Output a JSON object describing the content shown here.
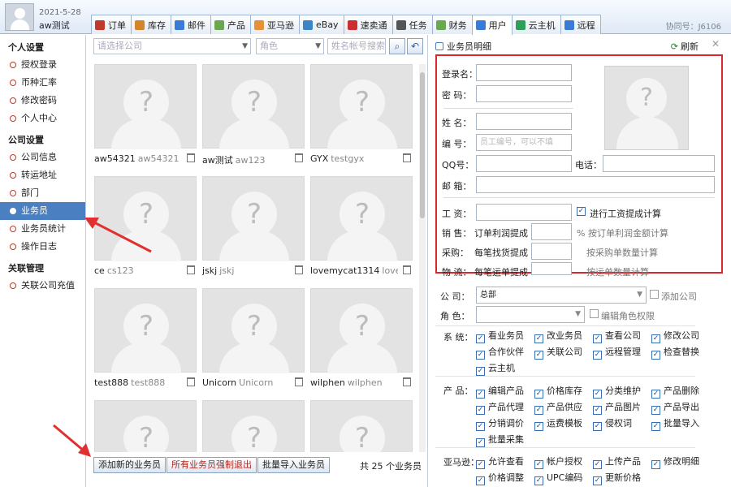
{
  "top": {
    "date": "2021-5-28",
    "user": "aw测试",
    "assistant_no": "协同号：J6106",
    "tabs": [
      {
        "label": "订单",
        "icon": "order-icon",
        "color": "#c0392b"
      },
      {
        "label": "库存",
        "icon": "stock-icon",
        "color": "#d4842a"
      },
      {
        "label": "邮件",
        "icon": "mail-icon",
        "color": "#3a7bd5"
      },
      {
        "label": "产品",
        "icon": "product-icon",
        "color": "#6aa84f"
      },
      {
        "label": "亚马逊",
        "icon": "amazon-icon",
        "color": "#e69138"
      },
      {
        "label": "eBay",
        "icon": "ebay-icon",
        "color": "#3d85c6"
      },
      {
        "label": "速卖通",
        "icon": "aliexpress-icon",
        "color": "#cc2f2f"
      },
      {
        "label": "任务",
        "icon": "task-icon",
        "color": "#555555"
      },
      {
        "label": "财务",
        "icon": "finance-icon",
        "color": "#6aa84f"
      },
      {
        "label": "用户",
        "icon": "user-icon",
        "color": "#3a7bd5"
      },
      {
        "label": "云主机",
        "icon": "cloud-host-icon",
        "color": "#2e9e5b"
      },
      {
        "label": "远程",
        "icon": "remote-icon",
        "color": "#3a7bd5"
      }
    ],
    "active_tab": "用户"
  },
  "nav": {
    "personal_title": "个人设置",
    "personal": [
      "授权登录",
      "币种汇率",
      "修改密码",
      "个人中心"
    ],
    "company_title": "公司设置",
    "company": [
      "公司信息",
      "转运地址",
      "部门",
      "业务员",
      "业务员统计",
      "操作日志"
    ],
    "related_title": "关联管理",
    "related": [
      "关联公司充值"
    ],
    "active": "业务员"
  },
  "filters": {
    "company_placeholder": "请选择公司",
    "role_placeholder": "角色",
    "search_placeholder": "姓名帐号搜索"
  },
  "cards": [
    {
      "name": "aw54321",
      "account": "aw54321"
    },
    {
      "name": "aw测试",
      "account": "aw123"
    },
    {
      "name": "GYX",
      "account": "testgyx"
    },
    {
      "name": "ce",
      "account": "cs123"
    },
    {
      "name": "jskj",
      "account": "jskj"
    },
    {
      "name": "lovemycat1314",
      "account": "lovem"
    },
    {
      "name": "test888",
      "account": "test888"
    },
    {
      "name": "Unicorn",
      "account": "Unicorn"
    },
    {
      "name": "wilphen",
      "account": "wilphen"
    }
  ],
  "bottom": {
    "add_btn": "添加新的业务员",
    "force_logout_btn": "所有业务员强制退出",
    "import_btn": "批量导入业务员",
    "total": "共 25 个业务员"
  },
  "detail": {
    "title": "业务员明细",
    "refresh": "刷新",
    "close": "✕",
    "login_label": "登录名：",
    "password_label": "密 码：",
    "name_label": "姓 名：",
    "number_label": "编 号：",
    "number_placeholder": "员工编号，可以不填",
    "qq_label": "QQ号：",
    "phone_label": "电话：",
    "email_label": "邮 箱：",
    "salary_label": "工 资：",
    "salary_calc": "进行工资提成计算",
    "sales_label": "销 售：",
    "sales_item": "订单利润提成",
    "sales_suffix": "% 按订单利润金额计算",
    "purchase_label": "采购：",
    "purchase_item": "每笔找货提成",
    "purchase_suffix": "按采购单数量计算",
    "logistics_label": "物 流：",
    "logistics_item": "每笔运单提成",
    "logistics_suffix": "按运单数量计算",
    "company_label": "公 司：",
    "company_value": "总部",
    "add_company": "添加公司",
    "role_label": "角 色：",
    "edit_role": "编辑角色权限",
    "system_label": "系 统：",
    "system_perms": [
      "看业务员",
      "改业务员",
      "查看公司",
      "修改公司",
      "合作伙伴",
      "关联公司",
      "远程管理",
      "检查替换",
      "云主机"
    ],
    "product_label": "产 品：",
    "product_perms": [
      "编辑产品",
      "价格库存",
      "分类维护",
      "产品删除",
      "产品代理",
      "产品供应",
      "产品图片",
      "产品导出",
      "分销调价",
      "运费模板",
      "侵权词",
      "批量导入",
      "批量采集"
    ],
    "amazon_label": "亚马逊：",
    "amazon_perms": [
      "允许查看",
      "帐户授权",
      "上传产品",
      "修改明细",
      "价格调整",
      "UPC编码",
      "更新价格"
    ]
  }
}
